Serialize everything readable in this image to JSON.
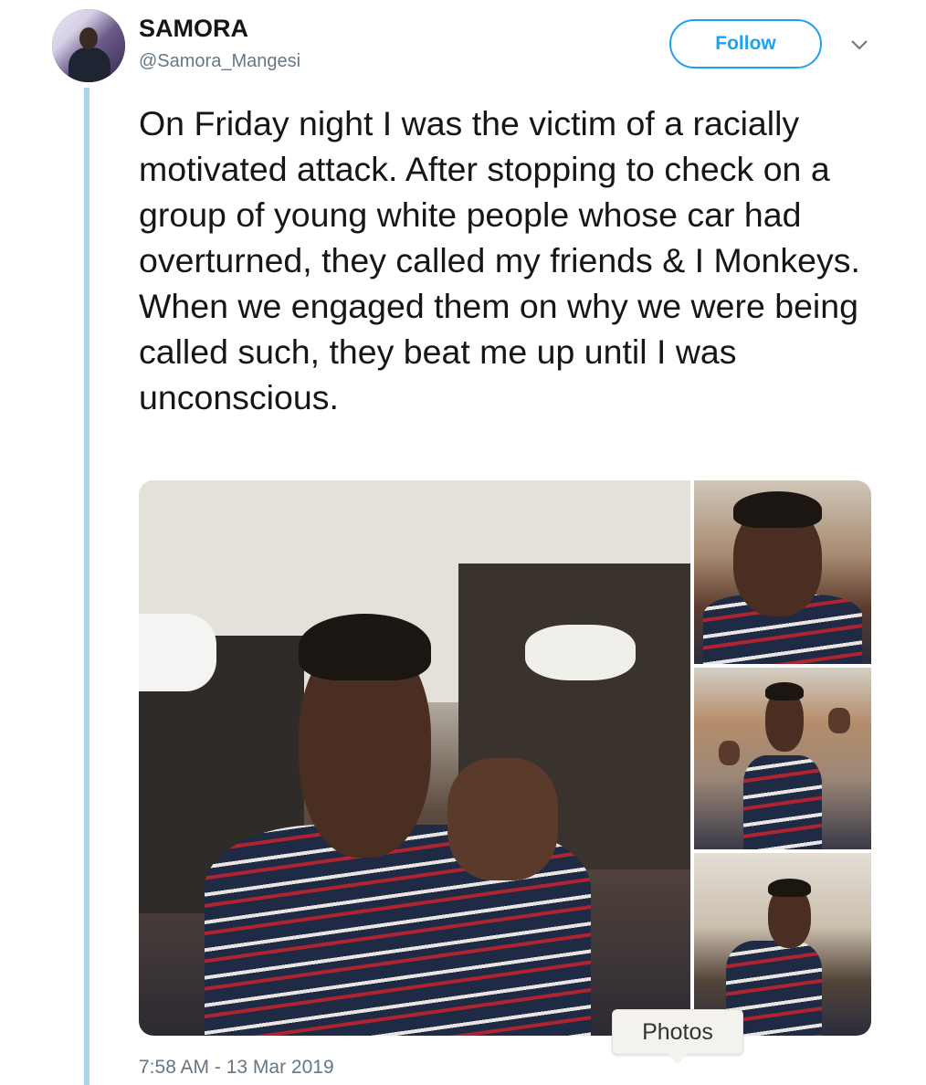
{
  "author": {
    "name": "SAMORA",
    "handle": "@Samora_Mangesi"
  },
  "actions": {
    "follow_label": "Follow",
    "more_icon": "chevron-down-icon"
  },
  "tweet": {
    "text": "On Friday night I was the victim of a racially motivated attack. After stopping to check on a group of young white people whose car had overturned, they called my friends & I Monkeys. When we engaged them on why we were being called such, they beat me up until I was unconscious.",
    "timestamp": "7:58 AM - 13 Mar 2019"
  },
  "media": {
    "photo_count": 4,
    "tooltip": "Photos"
  },
  "colors": {
    "accent": "#1da1f2",
    "thread_line": "#a9d4ee",
    "secondary_text": "#657786"
  }
}
